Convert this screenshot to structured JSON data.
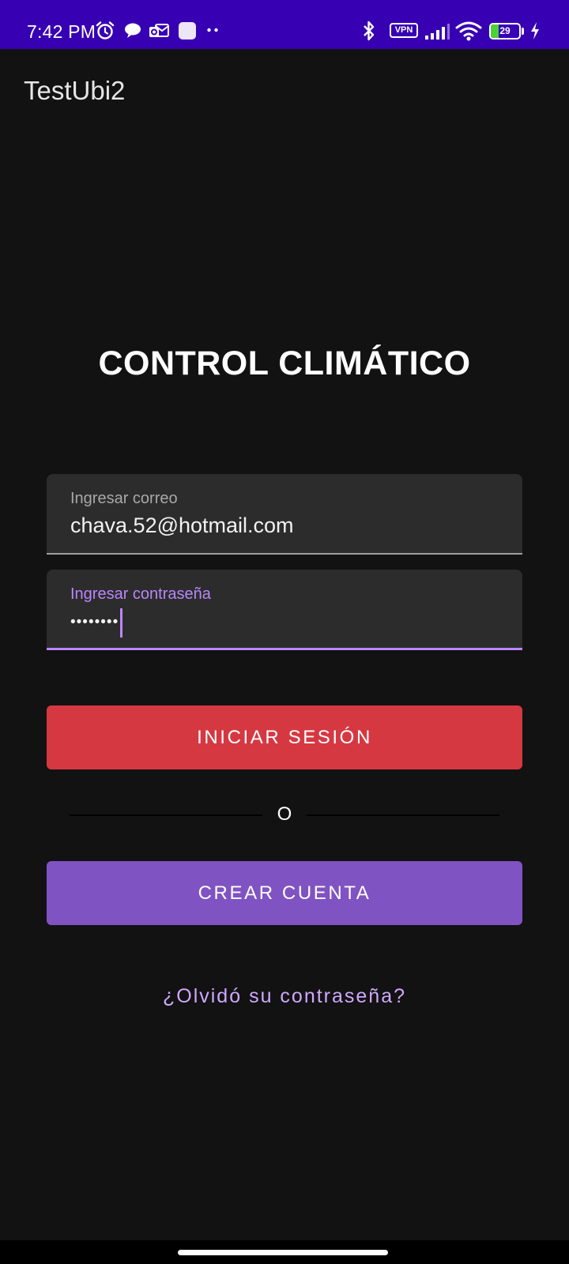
{
  "status_bar": {
    "time": "7:42 PM",
    "icons": [
      "alarm-icon",
      "chat-bubble-icon",
      "outlook-icon",
      "app-square-icon",
      "more-dots-icon",
      "bluetooth-icon",
      "vpn-icon",
      "signal-icon",
      "wifi-icon",
      "battery-icon",
      "charging-icon"
    ],
    "vpn_label": "VPN",
    "battery_level": "29",
    "battery_fraction": 0.29,
    "battery_fill_color": "#4cd137",
    "background_color": "#3700b3"
  },
  "app_bar": {
    "title": "TestUbi2"
  },
  "main": {
    "heading": "CONTROL CLIMÁTICO",
    "email_field": {
      "label": "Ingresar correo",
      "value": "chava.52@hotmail.com"
    },
    "password_field": {
      "label": "Ingresar contraseña",
      "masked_value": "••••••••"
    },
    "login_button": {
      "label": "INICIAR SESIÓN",
      "color": "#d63842"
    },
    "divider_text": "O",
    "create_button": {
      "label": "CREAR CUENTA",
      "color": "#8053c3"
    },
    "forgot_link": "¿Olvidó su contraseña?"
  },
  "colors": {
    "background": "#121212",
    "accent": "#bb86fc",
    "field_background": "#2c2c2c"
  }
}
